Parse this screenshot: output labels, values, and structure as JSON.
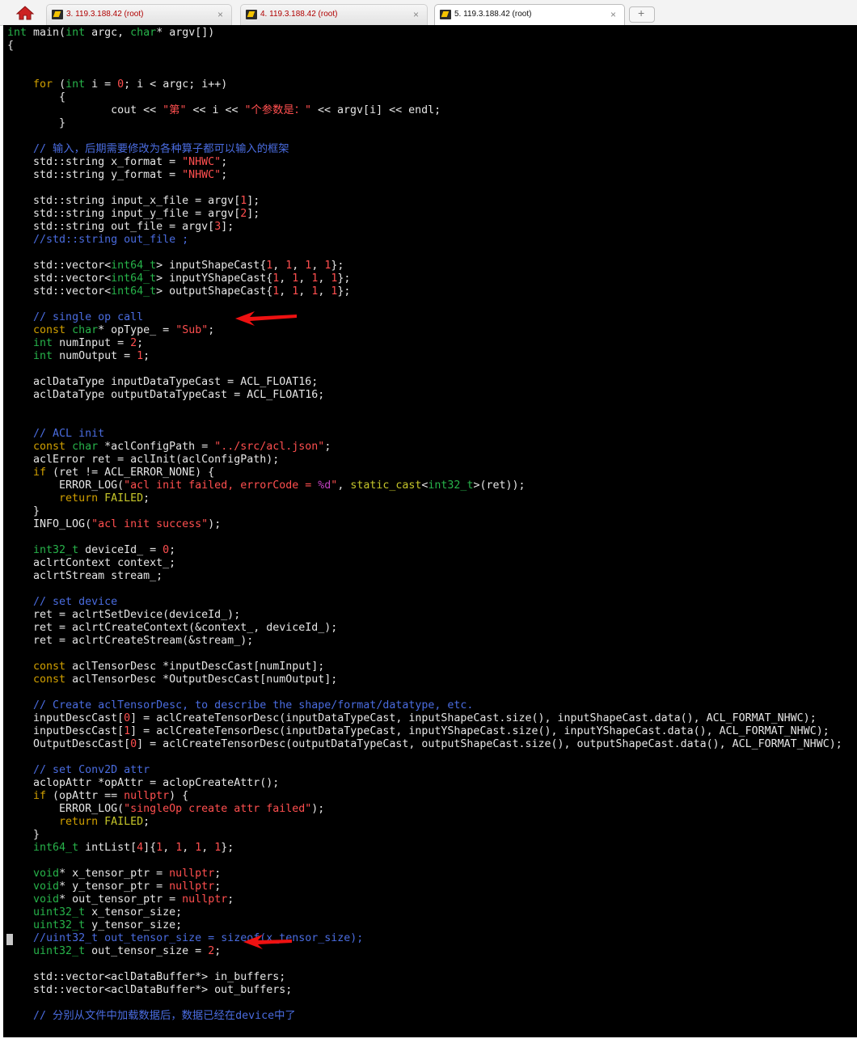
{
  "tabs": [
    {
      "label": "3. 119.3.188.42 (root)",
      "active": false
    },
    {
      "label": "4. 119.3.188.42 (root)",
      "active": false
    },
    {
      "label": "5. 119.3.188.42 (root)",
      "active": true
    }
  ],
  "icons": {
    "home": "home-icon",
    "terminal": "terminal-icon",
    "close": "close-icon",
    "new_tab": "new-tab-icon",
    "arrow": "red-arrow-annotation"
  },
  "colors": {
    "background": "#000000",
    "keyword": "#d1a000",
    "type": "#27b34a",
    "string": "#ff4f4f",
    "comment": "#4a6ce0",
    "annotation": "#ee1111"
  },
  "tab_close_glyph": "×",
  "code": [
    [
      [
        "int",
        "t"
      ],
      [
        " main(",
        "d"
      ],
      [
        "int",
        "t"
      ],
      [
        " argc, ",
        "d"
      ],
      [
        "char",
        "t"
      ],
      [
        "* argv[])",
        "d"
      ]
    ],
    [
      [
        "{",
        "d"
      ]
    ],
    [
      [
        "",
        "d"
      ]
    ],
    [
      [
        "",
        "d"
      ]
    ],
    [
      [
        "    ",
        "d"
      ],
      [
        "for",
        "k"
      ],
      [
        " (",
        "d"
      ],
      [
        "int",
        "t"
      ],
      [
        " i = ",
        "d"
      ],
      [
        "0",
        "n"
      ],
      [
        "; i < argc; i++)",
        "d"
      ]
    ],
    [
      [
        "        {",
        "d"
      ]
    ],
    [
      [
        "                cout << ",
        "d"
      ],
      [
        "\"第\"",
        "s"
      ],
      [
        " << i << ",
        "d"
      ],
      [
        "\"个参数是：\"",
        "s"
      ],
      [
        " << argv[i] << endl;",
        "d"
      ]
    ],
    [
      [
        "        }",
        "d"
      ]
    ],
    [
      [
        "",
        "d"
      ]
    ],
    [
      [
        "    ",
        "d"
      ],
      [
        "// 输入，后期需要修改为各种算子都可以输入的框架",
        "c"
      ]
    ],
    [
      [
        "    std::string x_format = ",
        "d"
      ],
      [
        "\"NHWC\"",
        "s"
      ],
      [
        ";",
        "d"
      ]
    ],
    [
      [
        "    std::string y_format = ",
        "d"
      ],
      [
        "\"NHWC\"",
        "s"
      ],
      [
        ";",
        "d"
      ]
    ],
    [
      [
        "",
        "d"
      ]
    ],
    [
      [
        "    std::string input_x_file = argv[",
        "d"
      ],
      [
        "1",
        "n"
      ],
      [
        "];",
        "d"
      ]
    ],
    [
      [
        "    std::string input_y_file = argv[",
        "d"
      ],
      [
        "2",
        "n"
      ],
      [
        "];",
        "d"
      ]
    ],
    [
      [
        "    std::string out_file = argv[",
        "d"
      ],
      [
        "3",
        "n"
      ],
      [
        "];",
        "d"
      ]
    ],
    [
      [
        "    ",
        "d"
      ],
      [
        "//std::string out_file ;",
        "c"
      ]
    ],
    [
      [
        "",
        "d"
      ]
    ],
    [
      [
        "    std::vector<",
        "d"
      ],
      [
        "int64_t",
        "t"
      ],
      [
        "> inputShapeCast{",
        "d"
      ],
      [
        "1",
        "n"
      ],
      [
        ", ",
        "d"
      ],
      [
        "1",
        "n"
      ],
      [
        ", ",
        "d"
      ],
      [
        "1",
        "n"
      ],
      [
        ", ",
        "d"
      ],
      [
        "1",
        "n"
      ],
      [
        "};",
        "d"
      ]
    ],
    [
      [
        "    std::vector<",
        "d"
      ],
      [
        "int64_t",
        "t"
      ],
      [
        "> inputYShapeCast{",
        "d"
      ],
      [
        "1",
        "n"
      ],
      [
        ", ",
        "d"
      ],
      [
        "1",
        "n"
      ],
      [
        ", ",
        "d"
      ],
      [
        "1",
        "n"
      ],
      [
        ", ",
        "d"
      ],
      [
        "1",
        "n"
      ],
      [
        "};",
        "d"
      ]
    ],
    [
      [
        "    std::vector<",
        "d"
      ],
      [
        "int64_t",
        "t"
      ],
      [
        "> outputShapeCast{",
        "d"
      ],
      [
        "1",
        "n"
      ],
      [
        ", ",
        "d"
      ],
      [
        "1",
        "n"
      ],
      [
        ", ",
        "d"
      ],
      [
        "1",
        "n"
      ],
      [
        ", ",
        "d"
      ],
      [
        "1",
        "n"
      ],
      [
        "};",
        "d"
      ]
    ],
    [
      [
        "",
        "d"
      ]
    ],
    [
      [
        "    ",
        "d"
      ],
      [
        "// single op call",
        "c"
      ]
    ],
    [
      [
        "    ",
        "d"
      ],
      [
        "const",
        "k"
      ],
      [
        " ",
        "d"
      ],
      [
        "char",
        "t"
      ],
      [
        "* opType_ = ",
        "d"
      ],
      [
        "\"Sub\"",
        "s"
      ],
      [
        ";",
        "d"
      ]
    ],
    [
      [
        "    ",
        "d"
      ],
      [
        "int",
        "t"
      ],
      [
        " numInput = ",
        "d"
      ],
      [
        "2",
        "n"
      ],
      [
        ";",
        "d"
      ]
    ],
    [
      [
        "    ",
        "d"
      ],
      [
        "int",
        "t"
      ],
      [
        " numOutput = ",
        "d"
      ],
      [
        "1",
        "n"
      ],
      [
        ";",
        "d"
      ]
    ],
    [
      [
        "",
        "d"
      ]
    ],
    [
      [
        "    aclDataType inputDataTypeCast = ACL_FLOAT16;",
        "d"
      ]
    ],
    [
      [
        "    aclDataType outputDataTypeCast = ACL_FLOAT16;",
        "d"
      ]
    ],
    [
      [
        "",
        "d"
      ]
    ],
    [
      [
        "",
        "d"
      ]
    ],
    [
      [
        "    ",
        "d"
      ],
      [
        "// ACL init",
        "c"
      ]
    ],
    [
      [
        "    ",
        "d"
      ],
      [
        "const",
        "k"
      ],
      [
        " ",
        "d"
      ],
      [
        "char",
        "t"
      ],
      [
        " *aclConfigPath = ",
        "d"
      ],
      [
        "\"../src/acl.json\"",
        "s"
      ],
      [
        ";",
        "d"
      ]
    ],
    [
      [
        "    aclError ret = aclInit(aclConfigPath);",
        "d"
      ]
    ],
    [
      [
        "    ",
        "d"
      ],
      [
        "if",
        "k"
      ],
      [
        " (ret != ACL_ERROR_NONE) {",
        "d"
      ]
    ],
    [
      [
        "        ERROR_LOG(",
        "d"
      ],
      [
        "\"acl init failed, errorCode = ",
        "s"
      ],
      [
        "%d",
        "m"
      ],
      [
        "\"",
        "s"
      ],
      [
        ", ",
        "d"
      ],
      [
        "static_cast",
        "f"
      ],
      [
        "<",
        "d"
      ],
      [
        "int32_t",
        "t"
      ],
      [
        ">(ret));",
        "d"
      ]
    ],
    [
      [
        "        ",
        "d"
      ],
      [
        "return",
        "k"
      ],
      [
        " ",
        "d"
      ],
      [
        "FAILED",
        "f"
      ],
      [
        ";",
        "d"
      ]
    ],
    [
      [
        "    }",
        "d"
      ]
    ],
    [
      [
        "    INFO_LOG(",
        "d"
      ],
      [
        "\"acl init success\"",
        "s"
      ],
      [
        ");",
        "d"
      ]
    ],
    [
      [
        "",
        "d"
      ]
    ],
    [
      [
        "    ",
        "d"
      ],
      [
        "int32_t",
        "t"
      ],
      [
        " deviceId_ = ",
        "d"
      ],
      [
        "0",
        "n"
      ],
      [
        ";",
        "d"
      ]
    ],
    [
      [
        "    aclrtContext context_;",
        "d"
      ]
    ],
    [
      [
        "    aclrtStream stream_;",
        "d"
      ]
    ],
    [
      [
        "",
        "d"
      ]
    ],
    [
      [
        "    ",
        "d"
      ],
      [
        "// set device",
        "c"
      ]
    ],
    [
      [
        "    ret = aclrtSetDevice(deviceId_);",
        "d"
      ]
    ],
    [
      [
        "    ret = aclrtCreateContext(&context_, deviceId_);",
        "d"
      ]
    ],
    [
      [
        "    ret = aclrtCreateStream(&stream_);",
        "d"
      ]
    ],
    [
      [
        "",
        "d"
      ]
    ],
    [
      [
        "    ",
        "d"
      ],
      [
        "const",
        "k"
      ],
      [
        " aclTensorDesc *inputDescCast[numInput];",
        "d"
      ]
    ],
    [
      [
        "    ",
        "d"
      ],
      [
        "const",
        "k"
      ],
      [
        " aclTensorDesc *OutputDescCast[numOutput];",
        "d"
      ]
    ],
    [
      [
        "",
        "d"
      ]
    ],
    [
      [
        "    ",
        "d"
      ],
      [
        "// Create aclTensorDesc, to describe the shape/format/datatype, etc.",
        "c"
      ]
    ],
    [
      [
        "    inputDescCast[",
        "d"
      ],
      [
        "0",
        "n"
      ],
      [
        "] = aclCreateTensorDesc(inputDataTypeCast, inputShapeCast.size(), inputShapeCast.data(), ACL_FORMAT_NHWC);",
        "d"
      ]
    ],
    [
      [
        "    inputDescCast[",
        "d"
      ],
      [
        "1",
        "n"
      ],
      [
        "] = aclCreateTensorDesc(inputDataTypeCast, inputYShapeCast.size(), inputYShapeCast.data(), ACL_FORMAT_NHWC);",
        "d"
      ]
    ],
    [
      [
        "    OutputDescCast[",
        "d"
      ],
      [
        "0",
        "n"
      ],
      [
        "] = aclCreateTensorDesc(outputDataTypeCast, outputShapeCast.size(), outputShapeCast.data(), ACL_FORMAT_NHWC);",
        "d"
      ]
    ],
    [
      [
        "",
        "d"
      ]
    ],
    [
      [
        "    ",
        "d"
      ],
      [
        "// set Conv2D attr",
        "c"
      ]
    ],
    [
      [
        "    aclopAttr *opAttr = aclopCreateAttr();",
        "d"
      ]
    ],
    [
      [
        "    ",
        "d"
      ],
      [
        "if",
        "k"
      ],
      [
        " (opAttr == ",
        "d"
      ],
      [
        "nullptr",
        "s"
      ],
      [
        ") {",
        "d"
      ]
    ],
    [
      [
        "        ERROR_LOG(",
        "d"
      ],
      [
        "\"singleOp create attr failed\"",
        "s"
      ],
      [
        ");",
        "d"
      ]
    ],
    [
      [
        "        ",
        "d"
      ],
      [
        "return",
        "k"
      ],
      [
        " ",
        "d"
      ],
      [
        "FAILED",
        "f"
      ],
      [
        ";",
        "d"
      ]
    ],
    [
      [
        "    }",
        "d"
      ]
    ],
    [
      [
        "    ",
        "d"
      ],
      [
        "int64_t",
        "t"
      ],
      [
        " intList[",
        "d"
      ],
      [
        "4",
        "n"
      ],
      [
        "]{",
        "d"
      ],
      [
        "1",
        "n"
      ],
      [
        ", ",
        "d"
      ],
      [
        "1",
        "n"
      ],
      [
        ", ",
        "d"
      ],
      [
        "1",
        "n"
      ],
      [
        ", ",
        "d"
      ],
      [
        "1",
        "n"
      ],
      [
        "};",
        "d"
      ]
    ],
    [
      [
        "",
        "d"
      ]
    ],
    [
      [
        "    ",
        "d"
      ],
      [
        "void",
        "t"
      ],
      [
        "* x_tensor_ptr = ",
        "d"
      ],
      [
        "nullptr",
        "s"
      ],
      [
        ";",
        "d"
      ]
    ],
    [
      [
        "    ",
        "d"
      ],
      [
        "void",
        "t"
      ],
      [
        "* y_tensor_ptr = ",
        "d"
      ],
      [
        "nullptr",
        "s"
      ],
      [
        ";",
        "d"
      ]
    ],
    [
      [
        "    ",
        "d"
      ],
      [
        "void",
        "t"
      ],
      [
        "* out_tensor_ptr = ",
        "d"
      ],
      [
        "nullptr",
        "s"
      ],
      [
        ";",
        "d"
      ]
    ],
    [
      [
        "    ",
        "d"
      ],
      [
        "uint32_t",
        "t"
      ],
      [
        " x_tensor_size;",
        "d"
      ]
    ],
    [
      [
        "    ",
        "d"
      ],
      [
        "uint32_t",
        "t"
      ],
      [
        " y_tensor_size;",
        "d"
      ]
    ],
    [
      [
        "    ",
        "d"
      ],
      [
        "//uint32_t out_tensor_size = sizeof(x_tensor_size);",
        "c"
      ]
    ],
    [
      [
        "    ",
        "d"
      ],
      [
        "uint32_t",
        "t"
      ],
      [
        " out_tensor_size = ",
        "d"
      ],
      [
        "2",
        "n"
      ],
      [
        ";",
        "d"
      ]
    ],
    [
      [
        "",
        "d"
      ]
    ],
    [
      [
        "    std::vector<aclDataBuffer*> in_buffers;",
        "d"
      ]
    ],
    [
      [
        "    std::vector<aclDataBuffer*> out_buffers;",
        "d"
      ]
    ],
    [
      [
        "",
        "d"
      ]
    ],
    [
      [
        "    ",
        "d"
      ],
      [
        "// 分别从文件中加载数据后，数据已经在device中了",
        "c"
      ]
    ]
  ]
}
